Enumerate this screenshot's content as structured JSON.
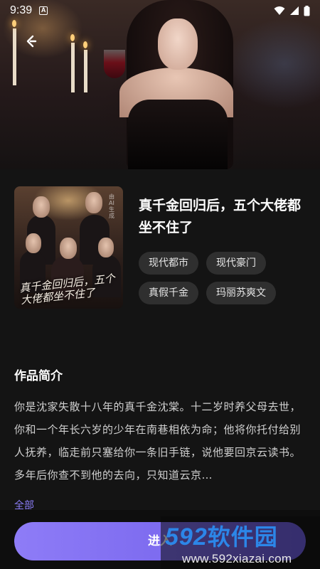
{
  "status_bar": {
    "time": "9:39",
    "notif_letter": "A"
  },
  "book": {
    "title": "真千金回归后，五个大佬都坐不住了",
    "cover_title": "真千金回归后，五个大佬都坐不住了",
    "cover_watermark": "由AI生成",
    "tags": [
      "现代都市",
      "现代豪门",
      "真假千金",
      "玛丽苏爽文"
    ]
  },
  "intro": {
    "heading": "作品简介",
    "text": "你是沈家失散十八年的真千金沈棠。十二岁时养父母去世，你和一个年长六岁的少年在南巷相依为命；他将你托付给别人抚养，临走前只塞给你一条旧手链，说他要回京云读书。多年后你查不到他的去向，只知道云京…",
    "more_label": "全部"
  },
  "actions": {
    "enter_label": "进入"
  },
  "watermark": {
    "logo_digits": "592",
    "logo_text": "软件园",
    "url": "www.592xiazai.com"
  },
  "colors": {
    "accent": "#8e7cf5",
    "background": "#141414",
    "watermark_blue": "#2c86e8"
  }
}
